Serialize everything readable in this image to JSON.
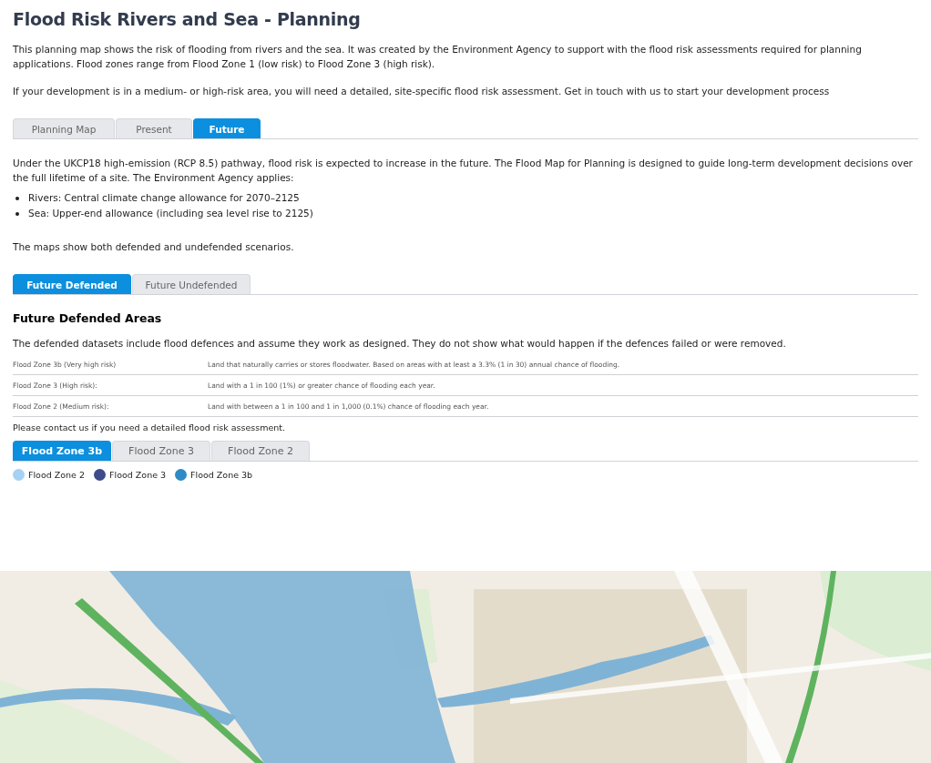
{
  "title": "Flood Risk Rivers and Sea - Planning",
  "intro": [
    "This planning map shows the risk of flooding from rivers and the sea. It was created by the Environment Agency to support with the flood risk assessments required for planning applications. Flood zones range from Flood Zone 1 (low risk) to Flood Zone 3 (high risk).",
    "If your development is in a medium- or high-risk area, you will need a detailed, site-specific flood risk assessment. Get in touch with us to start your development process"
  ],
  "main_tabs": [
    {
      "label": "Planning Map",
      "selected": false
    },
    {
      "label": "Present",
      "selected": false
    },
    {
      "label": "Future",
      "selected": true
    }
  ],
  "future_text": "Under the UKCP18 high-emission (RCP 8.5) pathway, flood risk is expected to increase in the future. The Flood Map for Planning is designed to guide long-term development decisions over the full lifetime of a site. The Environment Agency applies:",
  "bullets": [
    "Rivers: Central climate change allowance for 2070–2125",
    "Sea: Upper-end allowance (including sea level rise to 2125)"
  ],
  "scenario_text": "The maps show both defended and undefended scenarios.",
  "scenario_tabs": [
    {
      "label": "Future Defended",
      "selected": true
    },
    {
      "label": "Future Undefended",
      "selected": false
    }
  ],
  "section_heading": "Future Defended Areas",
  "section_text": "The defended datasets include flood defences and assume they work as designed. They do not show what would happen if the defences failed or were removed.",
  "zones_table": [
    {
      "zone": "Flood Zone 3b (Very high risk)",
      "description": "Land that naturally carries or stores floodwater. Based on areas with at least a 3.3% (1 in 30) annual chance of flooding."
    },
    {
      "zone": "Flood Zone 3 (High risk):",
      "description": "Land with a 1 in 100 (1%) or greater chance of flooding each year."
    },
    {
      "zone": "Flood Zone 2 (Medium risk):",
      "description": "Land with between a 1 in 100 and 1 in 1,000 (0.1%) chance of flooding each year."
    }
  ],
  "contact_text": "Please contact us if you need a detailed flood risk assessment.",
  "zone_tabs": [
    {
      "label": "Flood Zone 3b",
      "selected": true
    },
    {
      "label": "Flood Zone 3",
      "selected": false
    },
    {
      "label": "Flood Zone 2",
      "selected": false
    }
  ],
  "legend": [
    {
      "label": "Flood Zone 2",
      "color": "#a6d1f5"
    },
    {
      "label": "Flood Zone 3",
      "color": "#3d4a8c"
    },
    {
      "label": "Flood Zone 3b",
      "color": "#2f8bc4"
    }
  ],
  "map": {
    "kind": "picture"
  }
}
